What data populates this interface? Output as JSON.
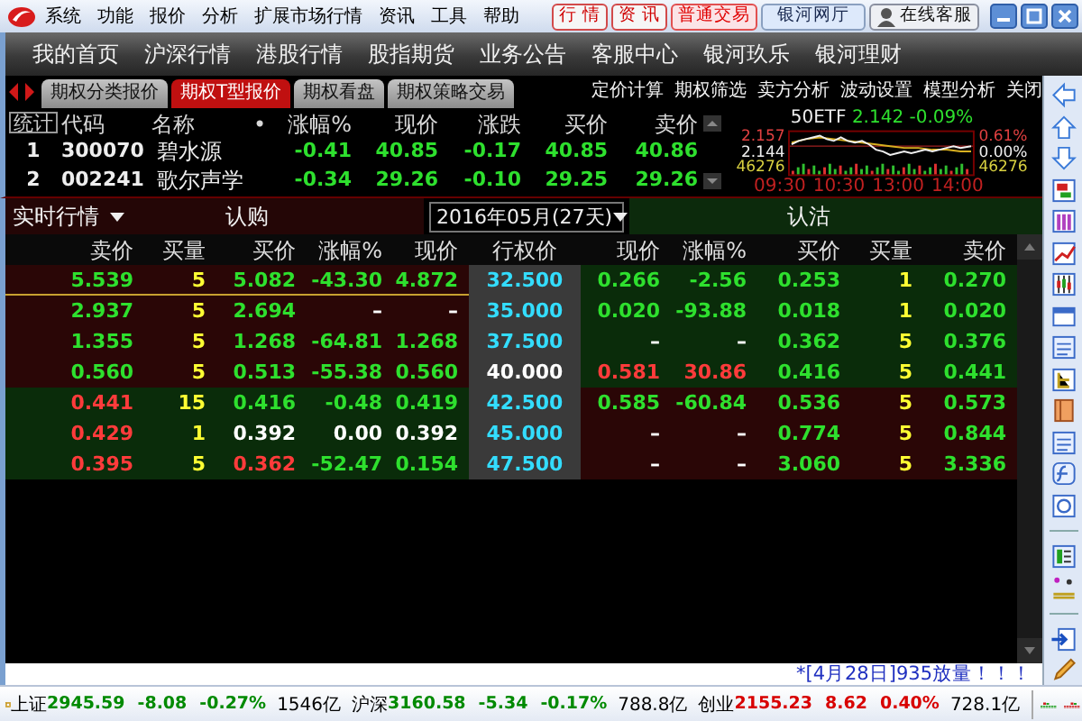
{
  "menu": {
    "items": [
      "系统",
      "功能",
      "报价",
      "分析",
      "扩展市场行情",
      "资讯",
      "工具",
      "帮助"
    ],
    "buttons": [
      {
        "label": "行 情",
        "kind": "red"
      },
      {
        "label": "资 讯",
        "kind": "red"
      },
      {
        "label": "普通交易",
        "kind": "redfill"
      },
      {
        "label": "银河网厅",
        "kind": "plain"
      },
      {
        "label": "在线客服",
        "kind": "service"
      }
    ]
  },
  "nav": {
    "items": [
      "我的首页",
      "沪深行情",
      "港股行情",
      "股指期货",
      "业务公告",
      "客服中心",
      "银河玖乐",
      "银河理财"
    ]
  },
  "tabs": [
    {
      "label": "期权分类报价",
      "selected": false
    },
    {
      "label": "期权T型报价",
      "selected": true
    },
    {
      "label": "期权看盘",
      "selected": false
    },
    {
      "label": "期权策略交易",
      "selected": false
    }
  ],
  "tab_actions": [
    "定价计算",
    "期权筛选",
    "卖方分析",
    "波动设置",
    "模型分析",
    "关闭"
  ],
  "watchlist": {
    "stats_label": "统计",
    "columns": [
      "代码",
      "名称",
      "•",
      "涨幅%",
      "现价",
      "涨跌",
      "买价",
      "卖价"
    ],
    "rows": [
      {
        "index": "1",
        "code": "300070",
        "name": "碧水源",
        "change_pct": "-0.41",
        "price": "40.85",
        "change": "-0.17",
        "bid": "40.85",
        "ask": "40.86",
        "color": "#2ee02e"
      },
      {
        "index": "2",
        "code": "002241",
        "name": "歌尔声学",
        "change_pct": "-0.34",
        "price": "29.26",
        "change": "-0.10",
        "bid": "29.25",
        "ask": "29.26",
        "color": "#2ee02e"
      }
    ]
  },
  "mini_chart": {
    "symbol": "50ETF",
    "price": "2.142",
    "change_pct": "-0.09%",
    "color": "#2ee02e",
    "left_labels": [
      "2.157",
      "2.144",
      "46276"
    ],
    "right_labels": [
      "0.61%",
      "0.00%",
      "46276"
    ],
    "times": [
      "09:30",
      "10:30",
      "13:00",
      "14:00"
    ]
  },
  "option_chain": {
    "mode": "实时行情",
    "call_label": "认购",
    "expiry": "2016年05月(27天)",
    "put_label": "认沽",
    "columns": [
      "卖价",
      "买量",
      "买价",
      "涨幅%",
      "现价",
      "行权价",
      "现价",
      "涨幅%",
      "买价",
      "买量",
      "卖价"
    ],
    "rows": [
      {
        "selected": true,
        "call_in_money": true,
        "cells": [
          {
            "text": "5.539",
            "color": "#2ee02e"
          },
          {
            "text": "5",
            "color": "#ffff33"
          },
          {
            "text": "5.082",
            "color": "#2ee02e"
          },
          {
            "text": "-43.30",
            "color": "#2ee02e"
          },
          {
            "text": "4.872",
            "color": "#2ee02e"
          },
          {
            "text": "32.500",
            "color": "#33ddff"
          },
          {
            "text": "0.266",
            "color": "#2ee02e"
          },
          {
            "text": "-2.56",
            "color": "#2ee02e"
          },
          {
            "text": "0.253",
            "color": "#2ee02e"
          },
          {
            "text": "1",
            "color": "#ffff33"
          },
          {
            "text": "0.270",
            "color": "#2ee02e"
          }
        ]
      },
      {
        "selected": false,
        "call_in_money": true,
        "cells": [
          {
            "text": "2.937",
            "color": "#2ee02e"
          },
          {
            "text": "5",
            "color": "#ffff33"
          },
          {
            "text": "2.694",
            "color": "#2ee02e"
          },
          {
            "text": "–",
            "color": "#ffffff"
          },
          {
            "text": "–",
            "color": "#ffffff"
          },
          {
            "text": "35.000",
            "color": "#33ddff"
          },
          {
            "text": "0.020",
            "color": "#2ee02e"
          },
          {
            "text": "-93.88",
            "color": "#2ee02e"
          },
          {
            "text": "0.018",
            "color": "#2ee02e"
          },
          {
            "text": "1",
            "color": "#ffff33"
          },
          {
            "text": "0.020",
            "color": "#2ee02e"
          }
        ]
      },
      {
        "selected": false,
        "call_in_money": true,
        "cells": [
          {
            "text": "1.355",
            "color": "#2ee02e"
          },
          {
            "text": "5",
            "color": "#ffff33"
          },
          {
            "text": "1.268",
            "color": "#2ee02e"
          },
          {
            "text": "-64.81",
            "color": "#2ee02e"
          },
          {
            "text": "1.268",
            "color": "#2ee02e"
          },
          {
            "text": "37.500",
            "color": "#33ddff"
          },
          {
            "text": "–",
            "color": "#ffffff"
          },
          {
            "text": "–",
            "color": "#ffffff"
          },
          {
            "text": "0.362",
            "color": "#2ee02e"
          },
          {
            "text": "5",
            "color": "#ffff33"
          },
          {
            "text": "0.376",
            "color": "#2ee02e"
          }
        ]
      },
      {
        "selected": false,
        "call_in_money": true,
        "cells": [
          {
            "text": "0.560",
            "color": "#2ee02e"
          },
          {
            "text": "5",
            "color": "#ffff33"
          },
          {
            "text": "0.513",
            "color": "#2ee02e"
          },
          {
            "text": "-55.38",
            "color": "#2ee02e"
          },
          {
            "text": "0.560",
            "color": "#2ee02e"
          },
          {
            "text": "40.000",
            "color": "#ffffff"
          },
          {
            "text": "0.581",
            "color": "#ff3b3b"
          },
          {
            "text": "30.86",
            "color": "#ff3b3b"
          },
          {
            "text": "0.416",
            "color": "#2ee02e"
          },
          {
            "text": "5",
            "color": "#ffff33"
          },
          {
            "text": "0.441",
            "color": "#2ee02e"
          }
        ]
      },
      {
        "selected": false,
        "call_in_money": false,
        "cells": [
          {
            "text": "0.441",
            "color": "#ff3b3b"
          },
          {
            "text": "15",
            "color": "#ffff33"
          },
          {
            "text": "0.416",
            "color": "#2ee02e"
          },
          {
            "text": "-0.48",
            "color": "#2ee02e"
          },
          {
            "text": "0.419",
            "color": "#2ee02e"
          },
          {
            "text": "42.500",
            "color": "#33ddff"
          },
          {
            "text": "0.585",
            "color": "#2ee02e"
          },
          {
            "text": "-60.84",
            "color": "#2ee02e"
          },
          {
            "text": "0.536",
            "color": "#2ee02e"
          },
          {
            "text": "5",
            "color": "#ffff33"
          },
          {
            "text": "0.573",
            "color": "#2ee02e"
          }
        ]
      },
      {
        "selected": false,
        "call_in_money": false,
        "cells": [
          {
            "text": "0.429",
            "color": "#ff3b3b"
          },
          {
            "text": "1",
            "color": "#ffff33"
          },
          {
            "text": "0.392",
            "color": "#ffffff"
          },
          {
            "text": "0.00",
            "color": "#ffffff"
          },
          {
            "text": "0.392",
            "color": "#ffffff"
          },
          {
            "text": "45.000",
            "color": "#33ddff"
          },
          {
            "text": "–",
            "color": "#ffffff"
          },
          {
            "text": "–",
            "color": "#ffffff"
          },
          {
            "text": "0.774",
            "color": "#2ee02e"
          },
          {
            "text": "5",
            "color": "#ffff33"
          },
          {
            "text": "0.844",
            "color": "#2ee02e"
          }
        ]
      },
      {
        "selected": false,
        "call_in_money": false,
        "cells": [
          {
            "text": "0.395",
            "color": "#ff3b3b"
          },
          {
            "text": "5",
            "color": "#ffff33"
          },
          {
            "text": "0.362",
            "color": "#ff3b3b"
          },
          {
            "text": "-52.47",
            "color": "#2ee02e"
          },
          {
            "text": "0.154",
            "color": "#2ee02e"
          },
          {
            "text": "47.500",
            "color": "#33ddff"
          },
          {
            "text": "–",
            "color": "#ffffff"
          },
          {
            "text": "–",
            "color": "#ffffff"
          },
          {
            "text": "3.060",
            "color": "#2ee02e"
          },
          {
            "text": "5",
            "color": "#ffff33"
          },
          {
            "text": "3.336",
            "color": "#2ee02e"
          }
        ]
      }
    ]
  },
  "message": "*[4月28日]935放量！！！",
  "status_bar": {
    "indices": [
      {
        "name": "上证",
        "value": "2945.59",
        "change": "-8.08",
        "change_pct": "-0.27%",
        "amount": "1546亿",
        "color": "#008a00"
      },
      {
        "name": "沪深",
        "value": "3160.58",
        "change": "-5.34",
        "change_pct": "-0.17%",
        "amount": "788.8亿",
        "color": "#008a00"
      },
      {
        "name": "创业",
        "value": "2155.23",
        "change": "8.62",
        "change_pct": "0.40%",
        "amount": "728.1亿",
        "color": "#d80000"
      }
    ]
  }
}
